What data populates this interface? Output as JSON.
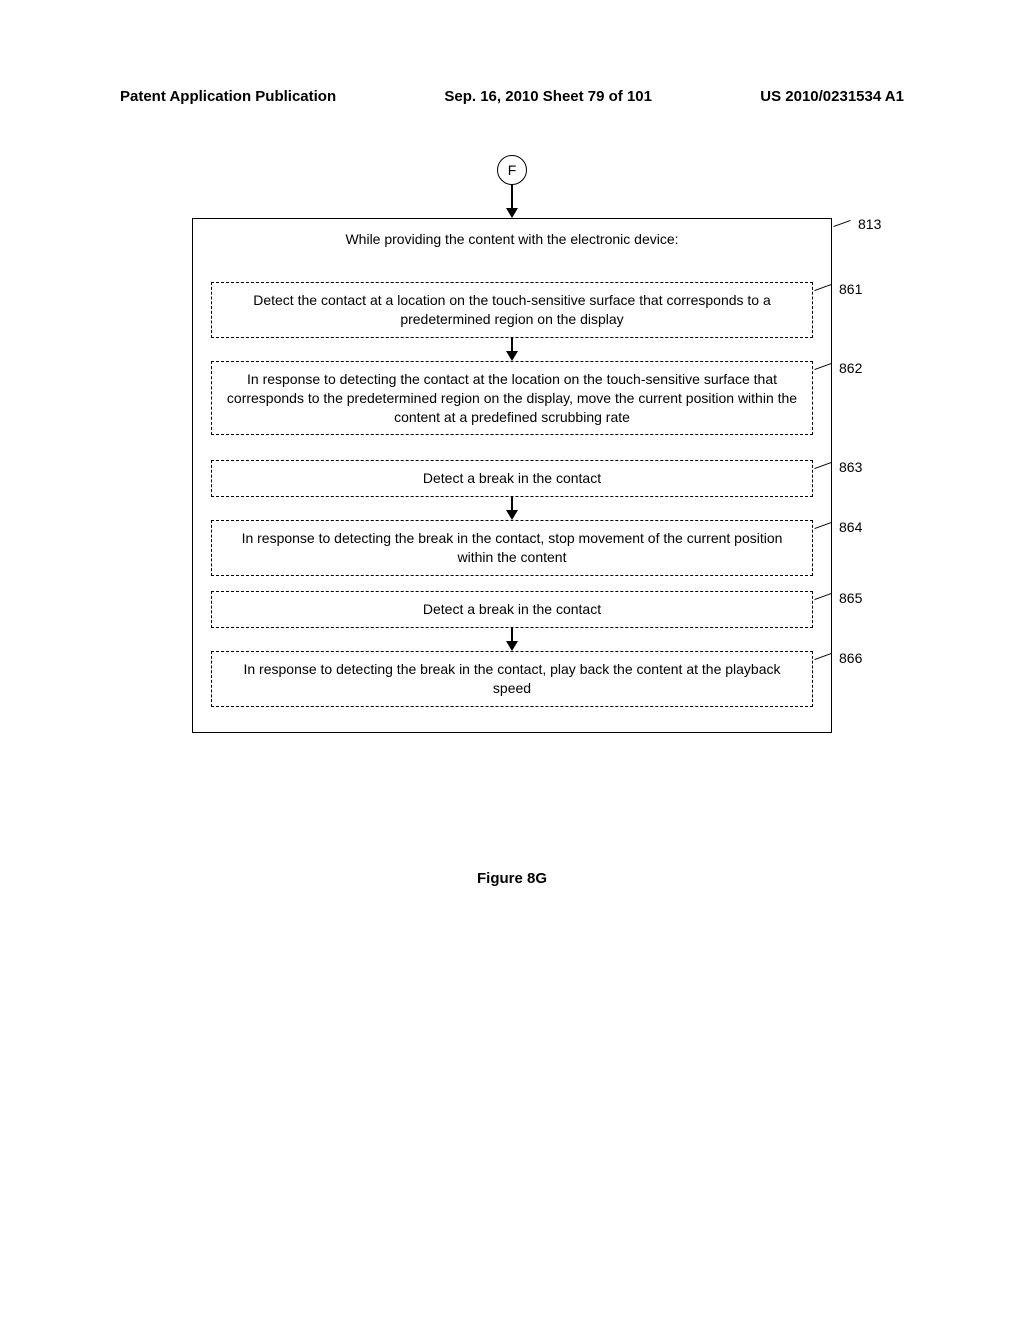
{
  "header": {
    "left": "Patent Application Publication",
    "center": "Sep. 16, 2010  Sheet 79 of 101",
    "right": "US 2010/0231534 A1"
  },
  "connector": "F",
  "outer_box_title": "While providing the content with the electronic device:",
  "boxes": {
    "b861": "Detect the contact at a location on the touch-sensitive surface that corresponds to a predetermined region on the display",
    "b862": "In response to detecting the contact at the location on the touch-sensitive surface that corresponds to the predetermined region on the display, move the current position within the content at a predefined scrubbing rate",
    "b863": "Detect a break in the contact",
    "b864": "In response to detecting the break in the contact, stop movement of the current position within the content",
    "b865": "Detect a break in the contact",
    "b866": "In response to detecting the break in the contact, play back the content at the playback speed"
  },
  "refs": {
    "r813": "813",
    "r861": "861",
    "r862": "862",
    "r863": "863",
    "r864": "864",
    "r865": "865",
    "r866": "866"
  },
  "figure": "Figure 8G"
}
